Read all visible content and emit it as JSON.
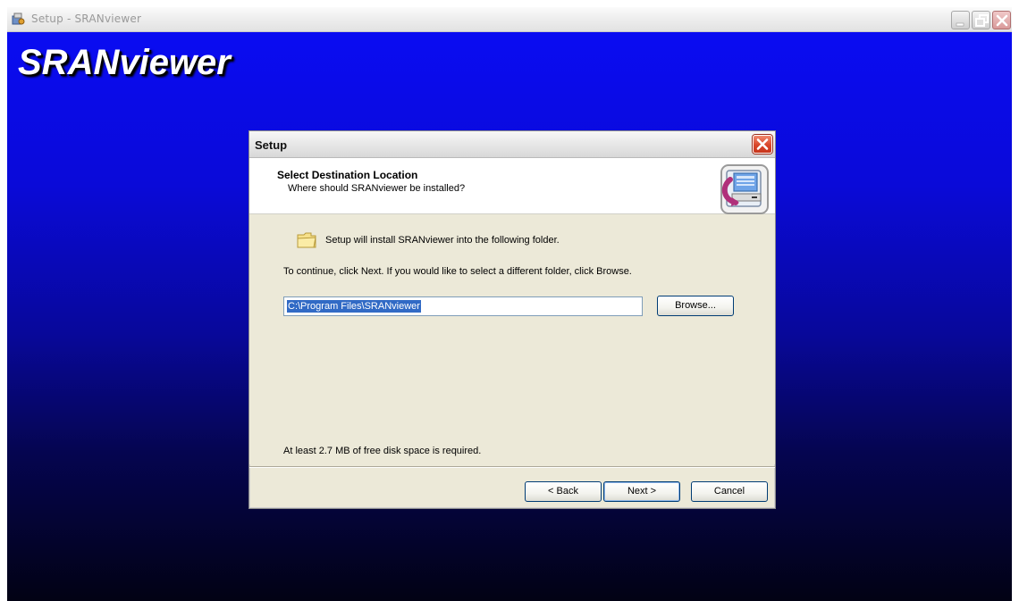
{
  "window": {
    "title": "Setup - SRANviewer",
    "brand": "SRANviewer"
  },
  "dialog": {
    "title": "Setup",
    "header": {
      "title": "Select Destination Location",
      "subtitle": "Where should SRANviewer be installed?"
    },
    "body": {
      "info": "Setup will install SRANviewer into the following folder.",
      "continue": "To continue, click Next. If you would like to select a different folder, click Browse.",
      "path_value": "C:\\Program Files\\SRANviewer",
      "browse_label": "Browse...",
      "disk_space": "At least 2.7 MB of free disk space is required."
    },
    "buttons": {
      "back": "< Back",
      "next": "Next >",
      "cancel": "Cancel"
    }
  },
  "icons": [
    "setup-app-icon",
    "minimize-icon",
    "restore-icon",
    "close-icon",
    "dialog-close-icon",
    "destination-computer-icon",
    "folder-icon"
  ],
  "colors": {
    "background_top": "#0a0cf6",
    "background_bottom": "#020214",
    "selection": "#316ac5",
    "dialog_close": "#d9462a"
  }
}
